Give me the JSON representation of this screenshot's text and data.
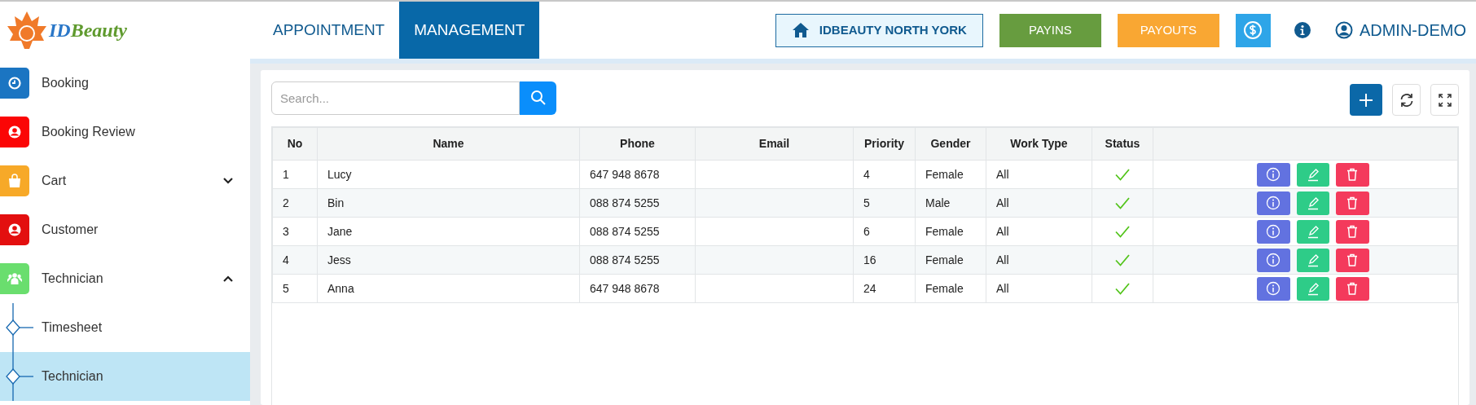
{
  "logo": {
    "parts": [
      "ID",
      "Beauty"
    ]
  },
  "nav_tabs": [
    {
      "label": "APPOINTMENT",
      "selected": false
    },
    {
      "label": "MANAGEMENT",
      "selected": true
    }
  ],
  "header_buttons": [
    {
      "label": "IDBEAUTY NORTH YORK",
      "kind": "location"
    },
    {
      "label": "PAYINS",
      "kind": "payin"
    },
    {
      "label": "PAYOUTS",
      "kind": "payout"
    }
  ],
  "user": "ADMIN-DEMO",
  "sidebar": {
    "items": [
      {
        "label": "Booking",
        "kind": "link",
        "color": "#1b75c2"
      },
      {
        "label": "Booking Review",
        "kind": "link",
        "color": "#fb0606"
      },
      {
        "label": "Cart",
        "kind": "group",
        "color": "#f7a928",
        "expanded": false
      },
      {
        "label": "Customer",
        "kind": "link",
        "color": "#e30f0f"
      },
      {
        "label": "Technician",
        "kind": "group",
        "color": "#6ade6e",
        "expanded": true,
        "children": [
          {
            "label": "Timesheet",
            "selected": false
          },
          {
            "label": "Technician",
            "selected": true
          }
        ]
      }
    ]
  },
  "search": {
    "placeholder": "Search..."
  },
  "table": {
    "columns": [
      "No",
      "Name",
      "Phone",
      "Email",
      "Priority",
      "Gender",
      "Work Type",
      "Status"
    ],
    "rows": [
      {
        "no": "1",
        "name": "Lucy",
        "phone": "647 948 8678",
        "priority": "4",
        "gender": "Female",
        "work_type": "All",
        "active": true
      },
      {
        "no": "2",
        "name": "Bin",
        "phone": "088 874 5255",
        "priority": "5",
        "gender": "Male",
        "work_type": "All",
        "active": true
      },
      {
        "no": "3",
        "name": "Jane",
        "phone": "088 874 5255",
        "priority": "6",
        "gender": "Female",
        "work_type": "All",
        "active": true
      },
      {
        "no": "4",
        "name": "Jess",
        "phone": "088 874 5255",
        "priority": "16",
        "gender": "Female",
        "work_type": "All",
        "active": true
      },
      {
        "no": "5",
        "name": "Anna",
        "phone": "647 948 8678",
        "priority": "24",
        "gender": "Female",
        "work_type": "All",
        "active": true
      }
    ]
  }
}
